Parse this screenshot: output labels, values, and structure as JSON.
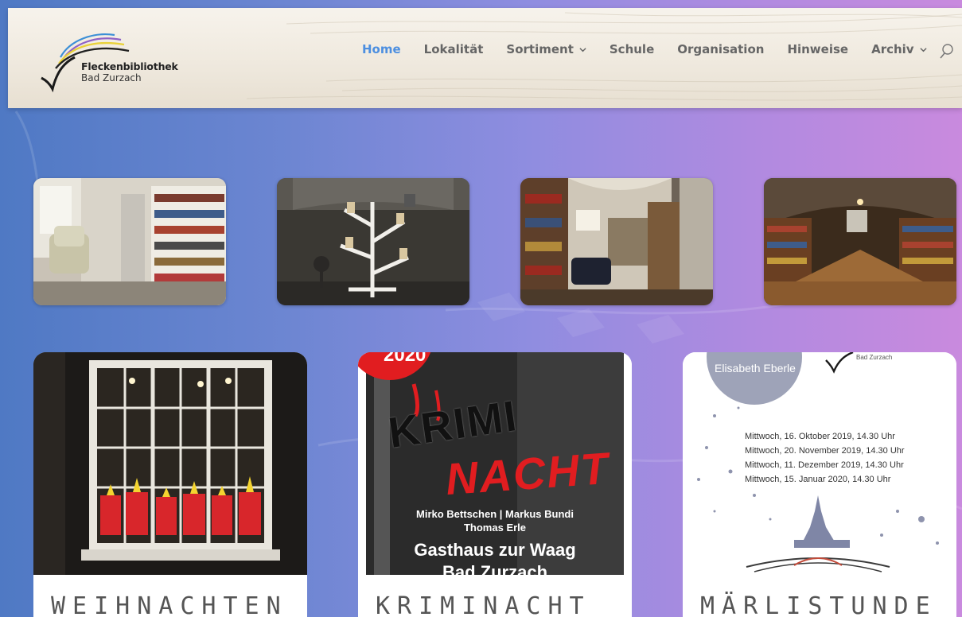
{
  "site": {
    "logo_title": "Fleckenbibliothek",
    "logo_subtitle": "Bad Zurzach"
  },
  "nav": {
    "items": [
      {
        "label": "Home",
        "active": true,
        "dropdown": false
      },
      {
        "label": "Lokalität",
        "active": false,
        "dropdown": false
      },
      {
        "label": "Sortiment",
        "active": false,
        "dropdown": true
      },
      {
        "label": "Schule",
        "active": false,
        "dropdown": false
      },
      {
        "label": "Organisation",
        "active": false,
        "dropdown": false
      },
      {
        "label": "Hinweise",
        "active": false,
        "dropdown": false
      },
      {
        "label": "Archiv",
        "active": false,
        "dropdown": true
      }
    ],
    "search_icon": "search-icon"
  },
  "gallery": [
    {
      "name": "reading-corner-photo"
    },
    {
      "name": "book-tree-shelf-photo"
    },
    {
      "name": "lounge-photo"
    },
    {
      "name": "vaulted-room-photo"
    }
  ],
  "cards": [
    {
      "title": "WEIHNACHTEN"
    },
    {
      "title": "KRIMINACHT",
      "poster": {
        "year": "2020",
        "krimi": "KRIMI",
        "nacht": "NACHT",
        "authors_1": "Mirko Bettschen | Markus Bundi",
        "authors_2": "Thomas Erle",
        "venue": "Gasthaus zur Waag",
        "town": "Bad Zurzach"
      }
    },
    {
      "title": "MÄRLISTUNDE",
      "poster": {
        "host": "Elisabeth Eberle",
        "brand": "Bad Zurzach",
        "dates": [
          "Mittwoch, 16. Oktober 2019, 14.30 Uhr",
          "Mittwoch, 20. November 2019, 14.30 Uhr",
          "Mittwoch, 11. Dezember 2019, 14.30 Uhr",
          "Mittwoch, 15. Januar 2020, 14.30 Uhr"
        ]
      }
    }
  ],
  "colors": {
    "nav_active": "#4d8fe0",
    "nav_default": "#666666",
    "bg_left": "#4f79c4",
    "bg_right": "#c98ade"
  }
}
